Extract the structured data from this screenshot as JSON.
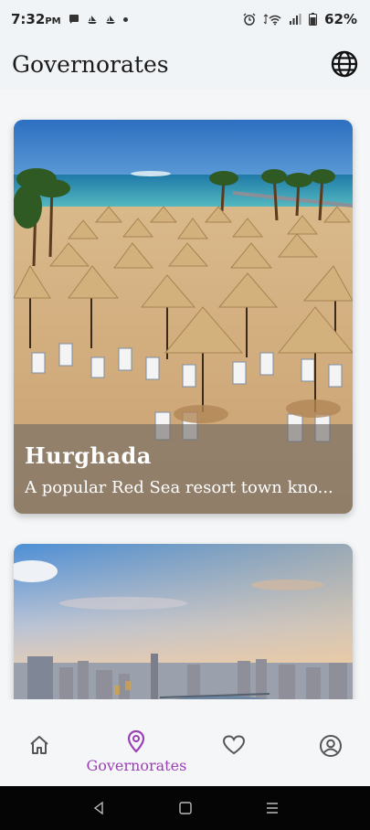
{
  "status_bar": {
    "time": "7:32",
    "ampm": "PM",
    "battery": "62%"
  },
  "app_bar": {
    "title": "Governorates",
    "language_icon": "globe-icon"
  },
  "cards": [
    {
      "title": "Hurghada",
      "description": "A popular Red Sea resort town kno..."
    },
    {
      "title": "",
      "description": ""
    }
  ],
  "bottom_nav": {
    "items": [
      {
        "icon": "home-icon",
        "label": ""
      },
      {
        "icon": "location-pin-icon",
        "label": "Governorates",
        "active": true
      },
      {
        "icon": "heart-icon",
        "label": ""
      },
      {
        "icon": "profile-icon",
        "label": ""
      }
    ],
    "active_color": "#9b3fb5",
    "inactive_color": "#666666"
  },
  "system_nav": {
    "items": [
      "back-icon",
      "home-square-icon",
      "recents-icon"
    ]
  }
}
